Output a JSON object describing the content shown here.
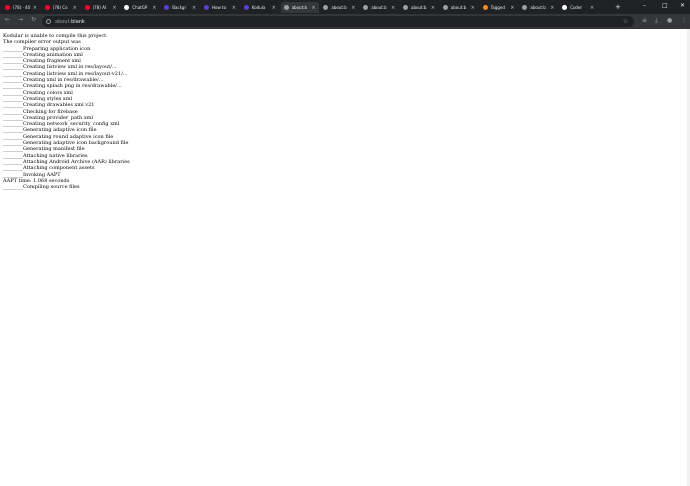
{
  "tabs": [
    {
      "title": "(78) · 40",
      "favicon_color": "#ff0033"
    },
    {
      "title": "(78) Co",
      "favicon_color": "#ff0033"
    },
    {
      "title": "(78) AI",
      "favicon_color": "#ff0033"
    },
    {
      "title": "ChatGP",
      "favicon_color": "#ffffff"
    },
    {
      "title": "Backgr",
      "favicon_color": "#5b3fd1"
    },
    {
      "title": "How to",
      "favicon_color": "#5b3fd1"
    },
    {
      "title": "Kodula",
      "favicon_color": "#5b3fd1"
    },
    {
      "title": "about:b",
      "favicon_color": "#9aa0a6"
    },
    {
      "title": "about:b",
      "favicon_color": "#9aa0a6"
    },
    {
      "title": "about:b",
      "favicon_color": "#9aa0a6"
    },
    {
      "title": "about:b",
      "favicon_color": "#9aa0a6"
    },
    {
      "title": "about:b",
      "favicon_color": "#9aa0a6"
    },
    {
      "title": "Tagged",
      "favicon_color": "#f28b25"
    },
    {
      "title": "about:b",
      "favicon_color": "#9aa0a6"
    },
    {
      "title": "Coder",
      "favicon_color": "#ffffff"
    }
  ],
  "active_tab_index": 7,
  "new_tab_label": "+",
  "window_controls": {
    "minimize": "–",
    "maximize": "□",
    "close": "✕"
  },
  "nav": {
    "back": "←",
    "forward": "→",
    "reload": "↻"
  },
  "address": {
    "scheme": "about:",
    "host": "blank"
  },
  "toolbar_icons": {
    "star": "☆",
    "extensions": "≡",
    "downloads": "⤓",
    "profile": "●",
    "menu": "⋮"
  },
  "log_lines": [
    "Kodular is unable to compile this project.",
    "The compiler error output was",
    "________Preparing application icon",
    "________Creating animation xml",
    "________Creating fragment xml",
    "________Creating listview xml in res/layout/...",
    "________Creating listview xml in res/layout-v21/...",
    "________Creating xml in res/drawable/...",
    "________Creating splash png in res/drawable/...",
    "________Creating colors xml",
    "________Creating styles xml",
    "________Creating drawables xml v21",
    "________Checking for firebase",
    "________Creating provider_path xml",
    "________Creating network_security_config xml",
    "________Generating adaptive icon file",
    "________Generating round adaptive icon file",
    "________Generating adaptive icon background file",
    "________Generating manifest file",
    "________Attaching native libraries",
    "________Attaching Android Archive (AAR) libraries",
    "________Attaching component assets",
    "________Invoking AAPT",
    "AAPT time: 1.068 seconds",
    "________Compiling source files"
  ]
}
